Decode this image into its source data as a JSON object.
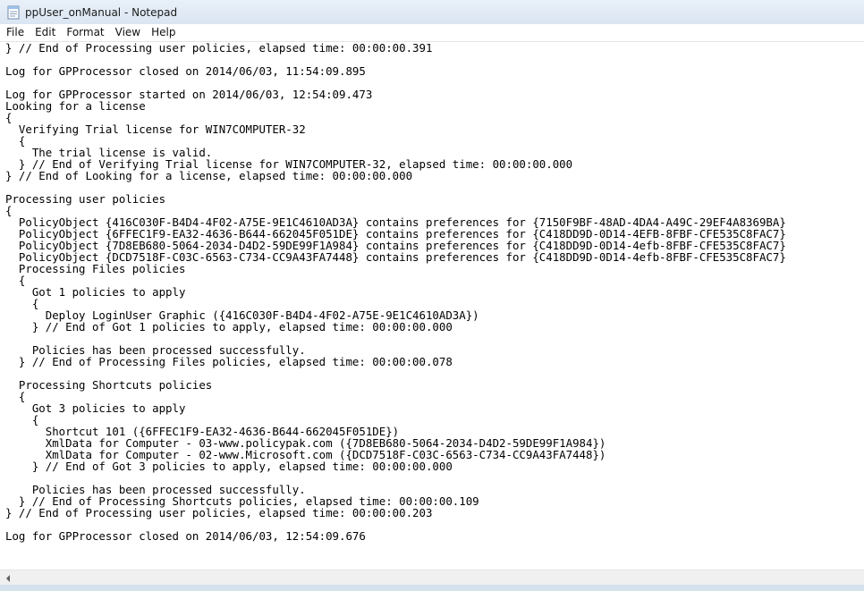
{
  "window": {
    "title": "ppUser_onManual - Notepad"
  },
  "menu": {
    "items": [
      "File",
      "Edit",
      "Format",
      "View",
      "Help"
    ]
  },
  "editor": {
    "lines": [
      "} // End of Processing user policies, elapsed time: 00:00:00.391",
      "",
      "Log for GPProcessor closed on 2014/06/03, 11:54:09.895",
      "",
      "Log for GPProcessor started on 2014/06/03, 12:54:09.473",
      "Looking for a license",
      "{",
      "  Verifying Trial license for WIN7COMPUTER-32",
      "  {",
      "    The trial license is valid.",
      "  } // End of Verifying Trial license for WIN7COMPUTER-32, elapsed time: 00:00:00.000",
      "} // End of Looking for a license, elapsed time: 00:00:00.000",
      "",
      "Processing user policies",
      "{",
      "  PolicyObject {416C030F-B4D4-4F02-A75E-9E1C4610AD3A} contains preferences for {7150F9BF-48AD-4DA4-A49C-29EF4A8369BA}",
      "  PolicyObject {6FFEC1F9-EA32-4636-B644-662045F051DE} contains preferences for {C418DD9D-0D14-4EFB-8FBF-CFE535C8FAC7}",
      "  PolicyObject {7D8EB680-5064-2034-D4D2-59DE99F1A984} contains preferences for {C418DD9D-0D14-4efb-8FBF-CFE535C8FAC7}",
      "  PolicyObject {DCD7518F-C03C-6563-C734-CC9A43FA7448} contains preferences for {C418DD9D-0D14-4efb-8FBF-CFE535C8FAC7}",
      "  Processing Files policies",
      "  {",
      "    Got 1 policies to apply",
      "    {",
      "      Deploy LoginUser Graphic ({416C030F-B4D4-4F02-A75E-9E1C4610AD3A})",
      "    } // End of Got 1 policies to apply, elapsed time: 00:00:00.000",
      "",
      "    Policies has been processed successfully.",
      "  } // End of Processing Files policies, elapsed time: 00:00:00.078",
      "",
      "  Processing Shortcuts policies",
      "  {",
      "    Got 3 policies to apply",
      "    {",
      "      Shortcut 101 ({6FFEC1F9-EA32-4636-B644-662045F051DE})",
      "      XmlData for Computer - 03-www.policypak.com ({7D8EB680-5064-2034-D4D2-59DE99F1A984})",
      "      XmlData for Computer - 02-www.Microsoft.com ({DCD7518F-C03C-6563-C734-CC9A43FA7448})",
      "    } // End of Got 3 policies to apply, elapsed time: 00:00:00.000",
      "",
      "    Policies has been processed successfully.",
      "  } // End of Processing Shortcuts policies, elapsed time: 00:00:00.109",
      "} // End of Processing user policies, elapsed time: 00:00:00.203",
      "",
      "Log for GPProcessor closed on 2014/06/03, 12:54:09.676"
    ]
  },
  "icons": {
    "app": "notepad-icon",
    "scroll_left": "scroll-left-arrow-icon"
  }
}
